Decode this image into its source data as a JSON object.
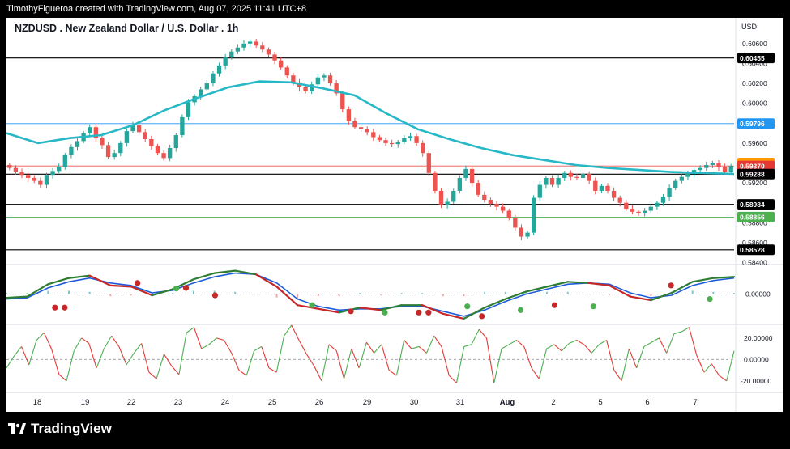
{
  "header": {
    "attribution": "TimothyFigueroa created with TradingView.com, Aug 07, 2025 11:41 UTC+8",
    "symbol": "NZDUSD . New Zealand Dollar / U.S. Dollar . 1h",
    "currency": "USD"
  },
  "brand": {
    "name": "TradingView"
  },
  "colors": {
    "up": "#26a69a",
    "down": "#ef5350",
    "ma": "#26b8c6",
    "macd_fast": "#2e7d32",
    "macd_slow": "#1e5bd8",
    "macd_down": "#c62828",
    "rsi_up": "#4caf50",
    "rsi_down": "#e53935",
    "tag_blue": "#2196f3",
    "tag_orange": "#ff9800",
    "tag_red": "#e53935",
    "tag_green": "#4caf50",
    "tag_black": "#000000"
  },
  "chart_data": {
    "type": "candlestick",
    "price_ylim": [
      0.5838,
      0.6068
    ],
    "price_ticks": [
      "0.60600",
      "0.60400",
      "0.60200",
      "0.60000",
      "0.59800",
      "0.59600",
      "0.59400",
      "0.59200",
      "0.59000",
      "0.58800",
      "0.58600",
      "0.58400"
    ],
    "x_ticks": [
      "18",
      "19",
      "22",
      "23",
      "24",
      "25",
      "26",
      "29",
      "30",
      "31",
      "Aug",
      "2",
      "5",
      "6",
      "7"
    ],
    "horizontal_levels": [
      {
        "label": "0.60455",
        "value": 0.60455,
        "line": "black",
        "tag": "black"
      },
      {
        "label": "0.59796",
        "value": 0.59796,
        "line": "blue",
        "tag": "blue"
      },
      {
        "label": "0.59400",
        "value": 0.594,
        "line": "orange",
        "tag": "orange"
      },
      {
        "label": "0.59370",
        "value": 0.5937,
        "line": "red",
        "tag": "red"
      },
      {
        "label": "0.59288",
        "value": 0.59288,
        "line": "black",
        "tag": "black"
      },
      {
        "label": "0.58984",
        "value": 0.58984,
        "line": "black",
        "tag": "black"
      },
      {
        "label": "0.58856",
        "value": 0.58856,
        "line": "green",
        "tag": "green"
      },
      {
        "label": "0.58528",
        "value": 0.58528,
        "line": "black",
        "tag": "black"
      }
    ],
    "closes": [
      0.5935,
      0.5931,
      0.5928,
      0.5925,
      0.5922,
      0.5918,
      0.5928,
      0.5932,
      0.5936,
      0.5948,
      0.5956,
      0.5962,
      0.597,
      0.5976,
      0.5965,
      0.5958,
      0.5946,
      0.595,
      0.596,
      0.5972,
      0.5978,
      0.5971,
      0.5964,
      0.5957,
      0.595,
      0.5945,
      0.5955,
      0.5968,
      0.5986,
      0.6001,
      0.6007,
      0.6014,
      0.602,
      0.603,
      0.6038,
      0.6046,
      0.6052,
      0.6056,
      0.606,
      0.6062,
      0.6058,
      0.6054,
      0.6049,
      0.6043,
      0.6036,
      0.6028,
      0.6021,
      0.6016,
      0.6012,
      0.6019,
      0.6026,
      0.6028,
      0.602,
      0.601,
      0.5994,
      0.5982,
      0.5976,
      0.5974,
      0.5971,
      0.5966,
      0.5963,
      0.596,
      0.5959,
      0.5961,
      0.5965,
      0.5967,
      0.596,
      0.595,
      0.593,
      0.5912,
      0.5898,
      0.5901,
      0.5912,
      0.5925,
      0.5934,
      0.592,
      0.5908,
      0.5903,
      0.5899,
      0.5896,
      0.5892,
      0.5885,
      0.5875,
      0.5866,
      0.587,
      0.5905,
      0.5918,
      0.5925,
      0.5918,
      0.5925,
      0.593,
      0.5926,
      0.5925,
      0.5929,
      0.5922,
      0.5912,
      0.5917,
      0.5912,
      0.5905,
      0.59,
      0.5894,
      0.5891,
      0.589,
      0.5892,
      0.5896,
      0.59,
      0.5906,
      0.5915,
      0.5922,
      0.5926,
      0.5929,
      0.5933,
      0.5935,
      0.5938,
      0.594,
      0.5936,
      0.5931,
      0.5937
    ],
    "ma_line": [
      0.597,
      0.596,
      0.5965,
      0.5968,
      0.5978,
      0.5993,
      0.6005,
      0.6016,
      0.6022,
      0.6021,
      0.6015,
      0.6008,
      0.599,
      0.5974,
      0.5964,
      0.5955,
      0.5948,
      0.5943,
      0.5938,
      0.5935,
      0.5933,
      0.5931,
      0.593,
      0.5929
    ],
    "macd_fast": [
      -0.3,
      -0.2,
      0.8,
      1.3,
      1.5,
      0.7,
      0.6,
      -0.1,
      0.4,
      1.2,
      1.7,
      1.9,
      1.6,
      0.6,
      -0.9,
      -1.2,
      -1.5,
      -1.1,
      -1.3,
      -0.9,
      -0.9,
      -1.6,
      -2.0,
      -1.1,
      -0.4,
      0.2,
      0.6,
      1.0,
      0.9,
      0.7,
      -0.2,
      -0.5,
      0.1,
      1.0,
      1.3,
      1.4
    ],
    "macd_slow": [
      -0.4,
      -0.3,
      0.5,
      1.0,
      1.3,
      0.9,
      0.7,
      0.1,
      0.3,
      0.9,
      1.4,
      1.7,
      1.6,
      0.9,
      -0.4,
      -1.0,
      -1.3,
      -1.2,
      -1.2,
      -1.0,
      -1.0,
      -1.4,
      -1.8,
      -1.3,
      -0.6,
      0.0,
      0.4,
      0.8,
      0.9,
      0.8,
      0.1,
      -0.3,
      -0.1,
      0.7,
      1.1,
      1.3
    ],
    "macd_ylim": [
      -2.4,
      2.4
    ],
    "macd_ticks": [
      "0.00000"
    ],
    "macd_dots": [
      [
        0.1,
        -1.1,
        "red"
      ],
      [
        0.12,
        -1.1,
        "red"
      ],
      [
        0.27,
        0.9,
        "red"
      ],
      [
        0.35,
        0.45,
        "green"
      ],
      [
        0.37,
        0.5,
        "red"
      ],
      [
        0.43,
        -0.1,
        "red"
      ],
      [
        0.63,
        -0.9,
        "green"
      ],
      [
        0.71,
        -1.4,
        "red"
      ],
      [
        0.78,
        -1.5,
        "green"
      ],
      [
        0.85,
        -1.5,
        "red"
      ],
      [
        0.87,
        -1.5,
        "red"
      ],
      [
        0.95,
        -1.0,
        "green"
      ],
      [
        0.98,
        -1.8,
        "red"
      ],
      [
        1.06,
        -1.3,
        "green"
      ],
      [
        1.13,
        -0.9,
        "red"
      ],
      [
        1.21,
        -1.0,
        "green"
      ],
      [
        1.37,
        0.7,
        "red"
      ],
      [
        1.45,
        -0.4,
        "green"
      ]
    ],
    "rsi": [
      -8,
      3,
      12,
      -5,
      18,
      25,
      10,
      -14,
      -20,
      8,
      20,
      15,
      -8,
      10,
      22,
      12,
      -5,
      6,
      15,
      -12,
      -18,
      5,
      -6,
      -14,
      25,
      30,
      10,
      14,
      20,
      18,
      6,
      -10,
      -15,
      8,
      12,
      -8,
      -12,
      22,
      32,
      18,
      5,
      -6,
      -20,
      14,
      8,
      -18,
      10,
      -8,
      16,
      6,
      14,
      -10,
      -15,
      18,
      10,
      12,
      6,
      22,
      12,
      -15,
      -22,
      12,
      14,
      28,
      20,
      -22,
      10,
      14,
      18,
      12,
      -8,
      -18,
      10,
      14,
      8,
      15,
      18,
      14,
      6,
      14,
      18,
      -10,
      -20,
      10,
      -8,
      12,
      16,
      20,
      6,
      24,
      26,
      30,
      4,
      -12,
      -4,
      -15,
      -20,
      8
    ],
    "rsi_ylim": [
      -30,
      32
    ],
    "rsi_ticks": [
      "20.00000",
      "0.00000",
      "-20.00000"
    ]
  }
}
